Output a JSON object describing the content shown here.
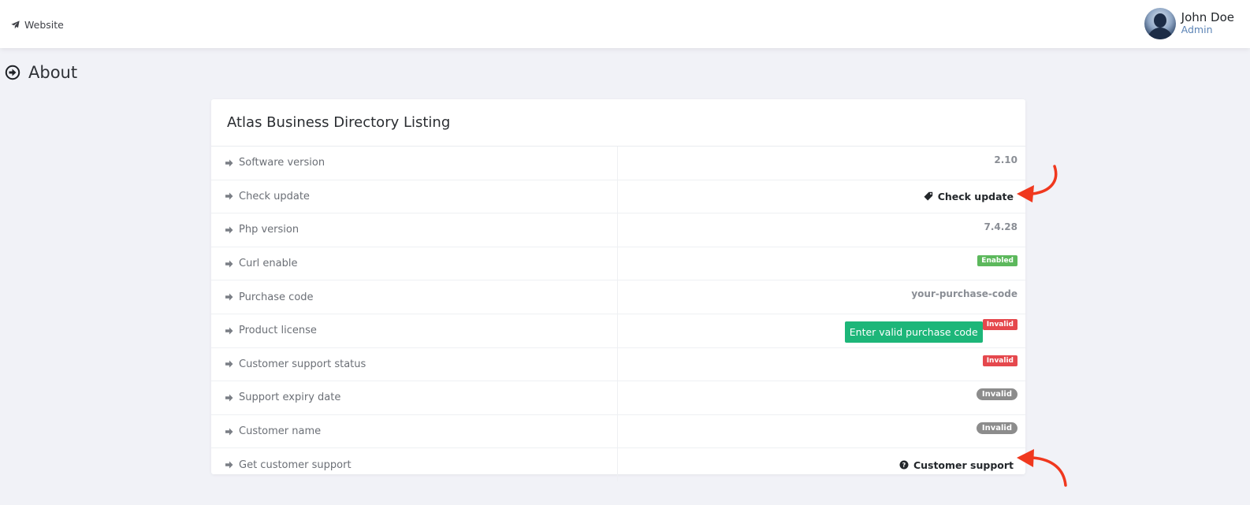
{
  "topbar": {
    "website_label": "Website",
    "user": {
      "name": "John Doe",
      "role": "Admin"
    }
  },
  "page": {
    "title": "About"
  },
  "card": {
    "title": "Atlas Business Directory Listing",
    "rows": [
      {
        "label": "Software version",
        "value": "2.10"
      },
      {
        "label": "Check update",
        "value": "Check update"
      },
      {
        "label": "Php version",
        "value": "7.4.28"
      },
      {
        "label": "Curl enable",
        "value": "Enabled"
      },
      {
        "label": "Purchase code",
        "value": "your-purchase-code"
      },
      {
        "label": "Product license",
        "button": "Enter valid purchase code",
        "value": "Invalid"
      },
      {
        "label": "Customer support status",
        "value": "Invalid"
      },
      {
        "label": "Support expiry date",
        "value": "Invalid"
      },
      {
        "label": "Customer name",
        "value": "Invalid"
      },
      {
        "label": "Get customer support",
        "value": "Customer support"
      }
    ]
  },
  "colors": {
    "enabled": "#5cb85c",
    "invalid_red": "#e5484d",
    "invalid_gray": "#8c8c8c",
    "button_green": "#1db679",
    "annotation_arrow": "#f0381e"
  },
  "icons": {
    "website": "paper-plane-icon",
    "title": "circle-arrow-right-icon",
    "row": "arrow-right-icon",
    "check_update": "tag-icon",
    "customer_support": "question-circle-icon"
  }
}
